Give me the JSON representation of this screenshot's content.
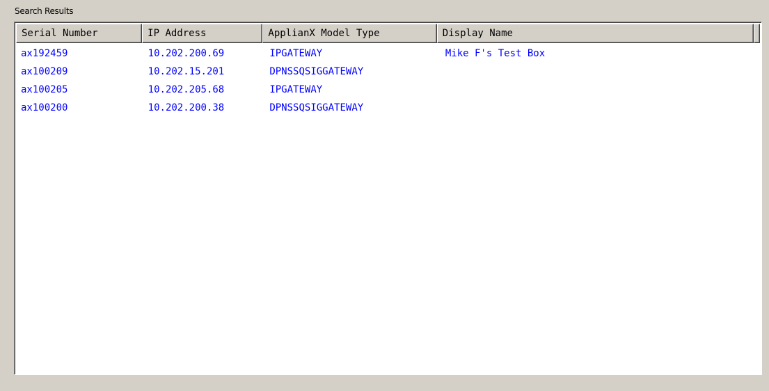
{
  "group": {
    "label": "Search Results"
  },
  "table": {
    "columns": [
      "Serial Number",
      "IP Address",
      "ApplianX Model Type",
      "Display Name"
    ],
    "rows": [
      [
        "ax192459",
        "10.202.200.69",
        "IPGATEWAY",
        "Mike F's Test Box"
      ],
      [
        "ax100209",
        "10.202.15.201",
        "DPNSSQSIGGATEWAY",
        ""
      ],
      [
        "ax100205",
        "10.202.205.68",
        "IPGATEWAY",
        ""
      ],
      [
        "ax100200",
        "10.202.200.38",
        "DPNSSQSIGGATEWAY",
        ""
      ]
    ]
  },
  "colors": {
    "window_bg": "#d4d0c8",
    "list_bg": "#ffffff",
    "row_text": "#0000ff"
  }
}
